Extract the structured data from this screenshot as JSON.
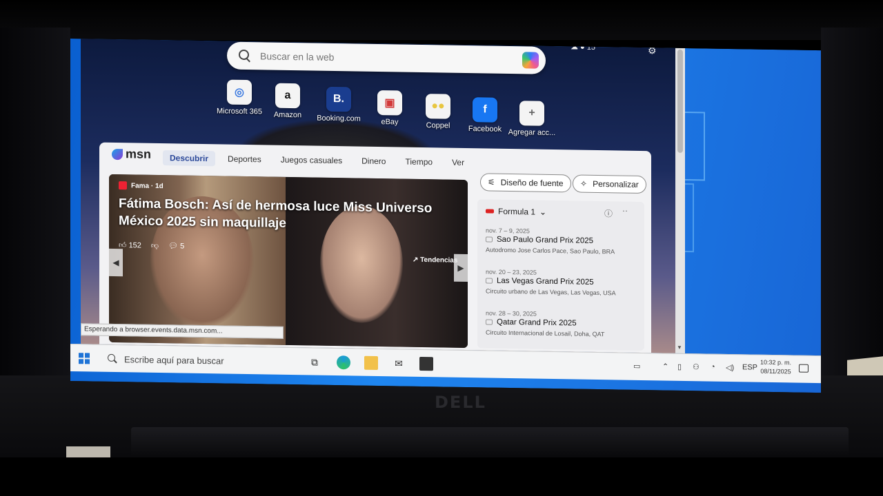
{
  "search": {
    "placeholder": "Buscar en la web"
  },
  "quick_links": [
    {
      "label": "Microsoft 365",
      "icon": "microsoft-365-icon",
      "glyph": "◎",
      "color": "#3d7be0"
    },
    {
      "label": "Amazon",
      "icon": "amazon-icon",
      "glyph": "a",
      "color": "#111111"
    },
    {
      "label": "Booking.com",
      "icon": "booking-icon",
      "glyph": "B.",
      "color": "#ffffff"
    },
    {
      "label": "eBay",
      "icon": "ebay-icon",
      "glyph": "▣",
      "color": "#d23a3a"
    },
    {
      "label": "Coppel",
      "icon": "coppel-icon",
      "glyph": "●●",
      "color": "#e8c640"
    },
    {
      "label": "Facebook",
      "icon": "facebook-icon",
      "glyph": "f",
      "color": "#ffffff"
    },
    {
      "label": "Agregar acc...",
      "icon": "add-icon",
      "glyph": "+",
      "color": "#666666"
    }
  ],
  "msn": {
    "logo": "msn",
    "nav": [
      "Descubrir",
      "Deportes",
      "Juegos casuales",
      "Dinero",
      "Tiempo",
      "Ver"
    ],
    "font_button": "Diseño de fuente",
    "personalize_button": "Personalizar",
    "hero": {
      "source": "Fama · 1d",
      "headline": "Fátima Bosch: Así de hermosa luce Miss Universo México 2025 sin maquillaje",
      "likes": "152",
      "comments": "5",
      "trend": "↗ Tendencias"
    },
    "f1": {
      "title": "Formula 1",
      "races": [
        {
          "date": "nov. 7 – 9, 2025",
          "name": "Sao Paulo Grand Prix 2025",
          "location": "Autodromo Jose Carlos Pace, Sao Paulo, BRA"
        },
        {
          "date": "nov. 20 – 23, 2025",
          "name": "Las Vegas Grand Prix 2025",
          "location": "Circuito urbano de Las Vegas, Las Vegas, USA"
        },
        {
          "date": "nov. 28 – 30, 2025",
          "name": "Qatar Grand Prix 2025",
          "location": "Circuito Internacional de Losail, Doha, QAT"
        }
      ]
    }
  },
  "status_bar": "Esperando a browser.events.data.msn.com...",
  "taskbar": {
    "search_placeholder": "Escribe aquí para buscar",
    "language": "ESP",
    "time": "10:32 p. m.",
    "date": "08/11/2025"
  },
  "laptop_brand": "DELL"
}
